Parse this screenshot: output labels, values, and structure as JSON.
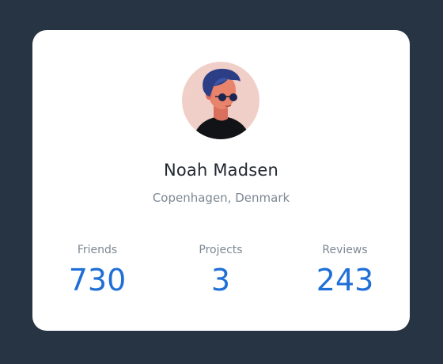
{
  "profile": {
    "name": "Noah Madsen",
    "location": "Copenhagen, Denmark",
    "avatar_icon": "user-avatar-illustration"
  },
  "stats": [
    {
      "label": "Friends",
      "value": "730"
    },
    {
      "label": "Projects",
      "value": "3"
    },
    {
      "label": "Reviews",
      "value": "243"
    }
  ],
  "colors": {
    "page_background": "#263444",
    "card_background": "#ffffff",
    "value_blue": "#1f6fd6",
    "muted_text": "#7d8894",
    "avatar_background": "#f1cfc9"
  }
}
